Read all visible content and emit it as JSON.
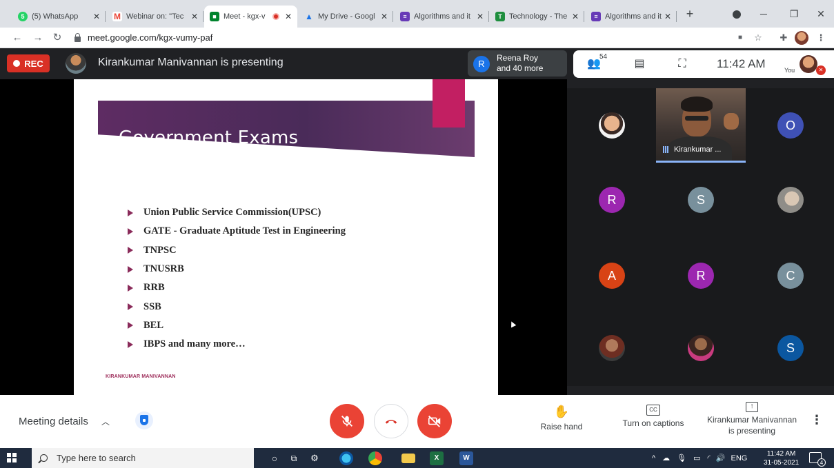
{
  "browser": {
    "tabs": [
      {
        "label": "(5) WhatsApp",
        "icon": "whatsapp-icon",
        "color": "#25d366",
        "glyph": "5"
      },
      {
        "label": "Webinar on: \"Tec",
        "icon": "gmail-icon",
        "color": "#ea4335",
        "glyph": "M"
      },
      {
        "label": "Meet - kgx-v",
        "icon": "meet-icon",
        "color": "#00832d",
        "glyph": "■"
      },
      {
        "label": "My Drive - Googl",
        "icon": "drive-icon",
        "color": "#fbbc04",
        "glyph": "▲"
      },
      {
        "label": "Algorithms and it",
        "icon": "forms-icon",
        "color": "#673ab7",
        "glyph": "≡"
      },
      {
        "label": "Technology - The",
        "icon": "classroom-icon",
        "color": "#1e8e3e",
        "glyph": "T"
      },
      {
        "label": "Algorithms and it",
        "icon": "forms-icon",
        "color": "#673ab7",
        "glyph": "≡"
      }
    ],
    "new_tab": "+",
    "url": "meet.google.com/kgx-vumy-paf"
  },
  "meet": {
    "rec_label": "REC",
    "presenting_title": "Kirankumar Manivannan is presenting",
    "pinned": {
      "initial": "R",
      "line1": "Reena Roy",
      "line2": "and 40 more"
    },
    "people_count": "54",
    "clock": "11:42 AM",
    "you_label": "You",
    "video_tile_label": "Kirankumar ...",
    "participants": [
      {
        "initial": "",
        "color": "#e8b48d",
        "photo": true
      },
      {
        "initial": "O",
        "color": "#3f51b5"
      },
      {
        "initial": "R",
        "color": "#9c27b0"
      },
      {
        "initial": "S",
        "color": "#78909c"
      },
      {
        "initial": "",
        "color": "#b0a59a",
        "photo": true
      },
      {
        "initial": "A",
        "color": "#d84315"
      },
      {
        "initial": "R",
        "color": "#9c27b0"
      },
      {
        "initial": "C",
        "color": "#78909c"
      },
      {
        "initial": "",
        "color": "#8d4e36",
        "photo": true
      },
      {
        "initial": "",
        "color": "#7a3b5e",
        "photo": true
      },
      {
        "initial": "S",
        "color": "#0b57a0"
      }
    ]
  },
  "slide": {
    "title": "Government Exams",
    "items": [
      "Union Public Service Commission(UPSC)",
      "GATE - Graduate Aptitude Test in Engineering",
      "TNPSC",
      "TNUSRB",
      "RRB",
      "SSB",
      "BEL",
      "IBPS and many more…"
    ],
    "footer": "KIRANKUMAR MANIVANNAN"
  },
  "bottom": {
    "meeting_details": "Meeting details",
    "raise_hand": "Raise hand",
    "captions": "Turn on captions",
    "presenting_line1": "Kirankumar Manivannan",
    "presenting_line2": "is presenting"
  },
  "taskbar": {
    "search_placeholder": "Type here to search",
    "lang": "ENG",
    "time": "11:42 AM",
    "date": "31-05-2021",
    "notifications": "4"
  }
}
